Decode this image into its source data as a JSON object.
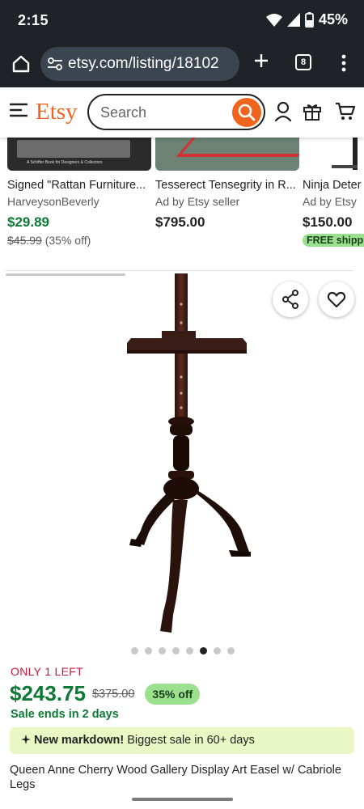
{
  "status_bar": {
    "time": "2:15",
    "battery": "45%",
    "icons": [
      "wifi-icon",
      "cell-signal-icon",
      "battery-icon"
    ]
  },
  "browser": {
    "url": "etsy.com/listing/18102",
    "tab_count": "8",
    "icons": [
      "home-icon",
      "site-settings-icon",
      "new-tab-plus-icon",
      "tab-switcher-icon",
      "more-vert-icon"
    ]
  },
  "header": {
    "logo": "Etsy",
    "search_placeholder": "Search",
    "icons": [
      "menu-icon",
      "search-icon",
      "account-icon",
      "gift-icon",
      "cart-icon"
    ],
    "accent": "#f1641e"
  },
  "related": [
    {
      "title": "Signed \"Rattan Furniture...",
      "seller": "HarveysonBeverly",
      "price": "$29.89",
      "original_price": "$45.99",
      "discount": "(35% off)",
      "thumb_caption": "A Schiffer Book for Designers & Collectors"
    },
    {
      "title": "Tesserect Tensegrity in R...",
      "seller": "Ad by Etsy seller",
      "price": "$795.00"
    },
    {
      "title": "Ninja Deter",
      "seller": "Ad by Etsy",
      "price": "$150.00",
      "badge": "FREE shipping"
    }
  ],
  "listing": {
    "image_index": 6,
    "image_count": 8,
    "stock_note": "ONLY 1 LEFT",
    "price": "$243.75",
    "original_price": "$375.00",
    "discount_badge": "35% off",
    "sale_note": "Sale ends in 2 days",
    "markdown_title": "New markdown!",
    "markdown_text": " Biggest sale in 60+ days",
    "title": "Queen Anne Cherry Wood Gallery Display Art Easel w/ Cabriole Legs",
    "icons": [
      "share-icon",
      "heart-icon",
      "sparkle-icon"
    ],
    "sale_color": "#0c7a34",
    "alert_color": "#c9183a"
  }
}
